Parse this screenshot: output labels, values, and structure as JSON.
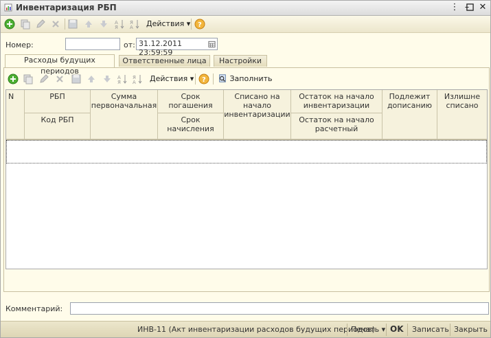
{
  "window": {
    "title": "Инвентаризация РБП"
  },
  "toolbar": {
    "actions_label": "Действия"
  },
  "header": {
    "number_label": "Номер:",
    "number_value": "",
    "date_label": "от:",
    "date_value": "31.12.2011 23:59:59"
  },
  "tabs": [
    {
      "label": "Расходы будущих периодов",
      "active": true
    },
    {
      "label": "Ответственные лица",
      "active": false
    },
    {
      "label": "Настройки",
      "active": false
    }
  ],
  "table_toolbar": {
    "actions_label": "Действия",
    "fill_label": "Заполнить"
  },
  "table": {
    "columns": {
      "n": "N",
      "rbp": "РБП",
      "rbp_code": "Код РБП",
      "sum_initial": "Сумма первоначальная",
      "repay_term": "Срок погашения",
      "accrual_term": "Срок начисления",
      "written_off": "Списано на начало инвентаризации",
      "balance_start": "Остаток на начало инвентаризации",
      "balance_calc": "Остаток на начало расчетный",
      "to_write": "Подлежит дописанию",
      "excess": "Излишне списано"
    },
    "rows": [
      {
        "n": "",
        "rbp": "",
        "sum": ""
      }
    ]
  },
  "comment": {
    "label": "Комментарий:",
    "value": ""
  },
  "footer": {
    "print_form": "ИНВ-11 (Акт инвентаризации расходов будущих периодов)",
    "print_label": "Печать",
    "ok_label": "OK",
    "save_label": "Записать",
    "close_label": "Закрыть"
  },
  "icons": {
    "add": "add-icon",
    "copy": "copy-icon",
    "edit": "edit-icon",
    "delete": "delete-icon",
    "save": "save-icon",
    "up": "arrow-up-icon",
    "down": "arrow-down-icon",
    "sort_asc": "sort-asc-icon",
    "sort_desc": "sort-desc-icon",
    "help": "help-icon",
    "calendar": "calendar-icon",
    "fill": "fill-icon"
  },
  "colors": {
    "background": "#fffcea",
    "accent_green": "#4caf32",
    "help_orange": "#e89a1c"
  }
}
